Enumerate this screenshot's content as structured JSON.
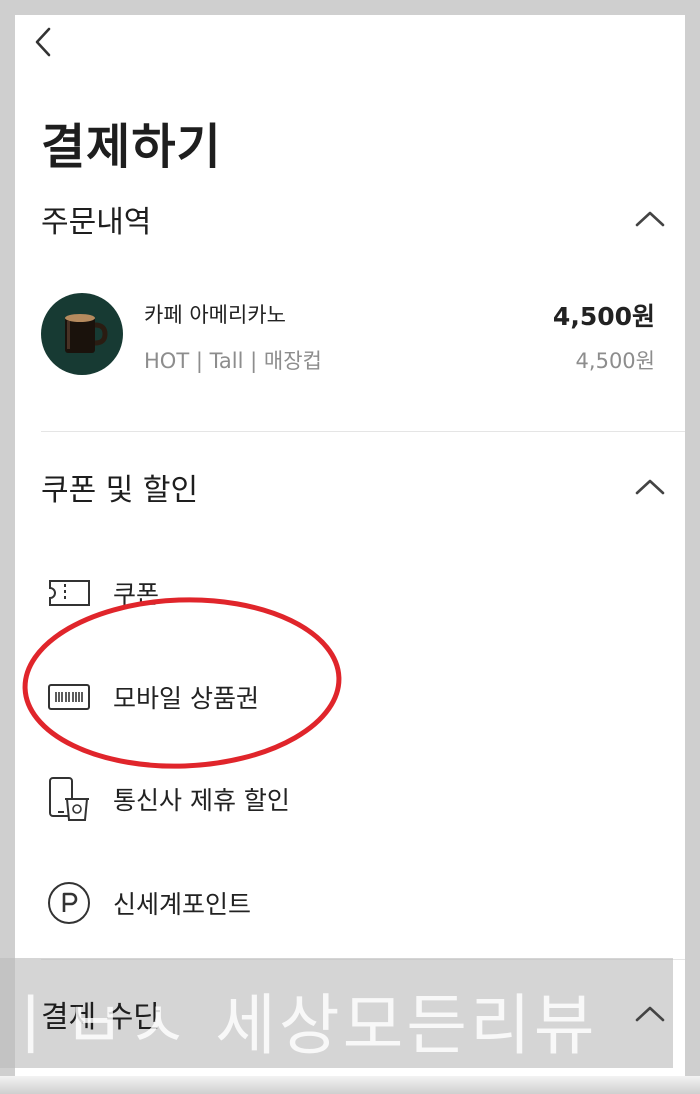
{
  "header": {
    "title": "결제하기"
  },
  "order_section": {
    "title": "주문내역",
    "item": {
      "name": "카페 아메리카노",
      "options": "HOT | Tall | 매장컵",
      "price": "4,500원",
      "unit_price": "4,500원"
    }
  },
  "discount_section": {
    "title": "쿠폰 및 할인",
    "items": [
      {
        "label": "쿠폰",
        "icon": "ticket-icon"
      },
      {
        "label": "모바일 상품권",
        "icon": "gift-card-icon"
      },
      {
        "label": "통신사 제휴 할인",
        "icon": "phone-cup-icon"
      },
      {
        "label": "신세계포인트",
        "icon": "point-p-icon"
      }
    ]
  },
  "payment_section": {
    "title": "결제 수단"
  },
  "watermark": {
    "text": "ㅣㅂㅅ 세상모든리뷰"
  },
  "colors": {
    "annotation": "#e0252b",
    "thumb_bg": "#173a33",
    "muted_text": "#8d8d8d"
  }
}
